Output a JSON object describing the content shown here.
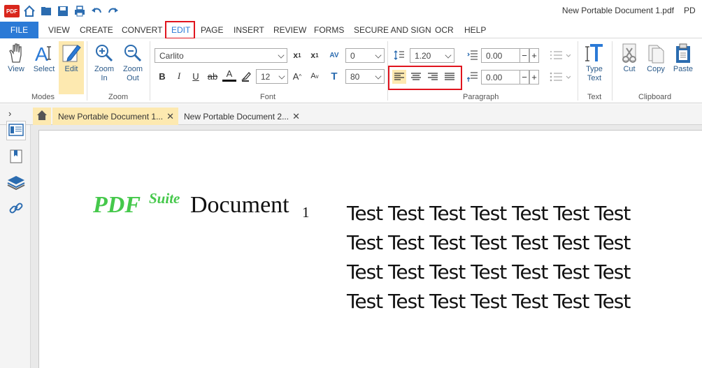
{
  "titlebar": {
    "title": "New Portable Document 1.pdf",
    "title_cut": "PD",
    "logo_text": "PDF"
  },
  "menu": {
    "items": [
      "FILE",
      "VIEW",
      "CREATE",
      "CONVERT",
      "EDIT",
      "PAGE",
      "INSERT",
      "REVIEW",
      "FORMS",
      "SECURE AND SIGN",
      "OCR",
      "HELP"
    ],
    "active": "EDIT"
  },
  "ribbon": {
    "modes": {
      "label": "Modes",
      "view": "View",
      "select": "Select",
      "edit": "Edit"
    },
    "zoom": {
      "label": "Zoom",
      "zoom_in_1": "Zoom",
      "zoom_in_2": "In",
      "zoom_out_1": "Zoom",
      "zoom_out_2": "Out"
    },
    "font": {
      "label": "Font",
      "family": "Carlito",
      "size": "12",
      "spacing": "0",
      "scale": "80",
      "bold": "B",
      "italic": "I",
      "underline": "U",
      "strike": "ab",
      "color_letter": "A"
    },
    "paragraph": {
      "label": "Paragraph",
      "line_spacing": "1.20",
      "indent_before": "0.00",
      "indent_after": "0.00"
    },
    "text": {
      "label": "Text",
      "type_text_1": "Type",
      "type_text_2": "Text"
    },
    "clipboard": {
      "label": "Clipboard",
      "cut": "Cut",
      "copy": "Copy",
      "paste": "Paste"
    }
  },
  "tabs": [
    {
      "label": "New Portable Document 1...",
      "active": true
    },
    {
      "label": "New Portable Document 2...",
      "active": false
    }
  ],
  "document": {
    "pdf": "PDF",
    "suite": "Suite",
    "doc": "Document",
    "sub": "1",
    "lines": [
      "Test Test Test Test Test Test Test",
      "Test Test Test Test Test Test Test",
      "Test Test Test Test Test Test Test",
      "Test Test Test Test Test Test Test"
    ]
  },
  "colors": {
    "accent": "#2b7ad6",
    "highlight": "#e0141e",
    "selected": "#fde9b0",
    "pdf_green": "#45c84b"
  }
}
